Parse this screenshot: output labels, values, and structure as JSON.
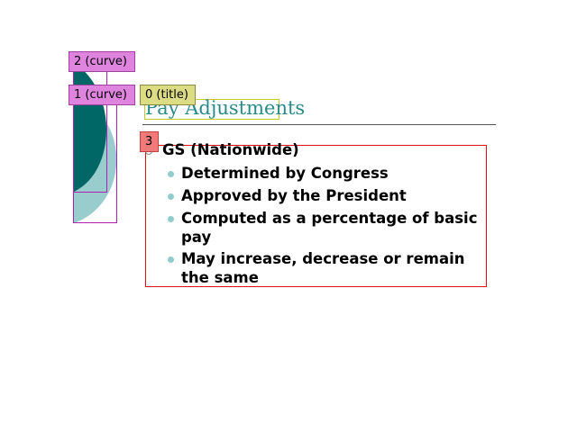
{
  "annotations": {
    "curve2_label": "2 (curve)",
    "curve1_label": "1 (curve)",
    "title_label": "0 (title)",
    "body_label": "3"
  },
  "slide": {
    "title": "Pay Adjustments",
    "heading": "GS (Nationwide)",
    "bullets": [
      "Determined by Congress",
      "Approved by the President",
      "Computed as a percentage of basic pay",
      "May increase, decrease or remain the same"
    ]
  },
  "colors": {
    "title": "#2a8a8a",
    "curve_dark": "#006666",
    "curve_light": "#99cccc",
    "bullet_dot": "#8fcccc",
    "annotation_curve": "#de84de",
    "annotation_title": "#dcdc84",
    "annotation_body": "#f07a7a"
  }
}
